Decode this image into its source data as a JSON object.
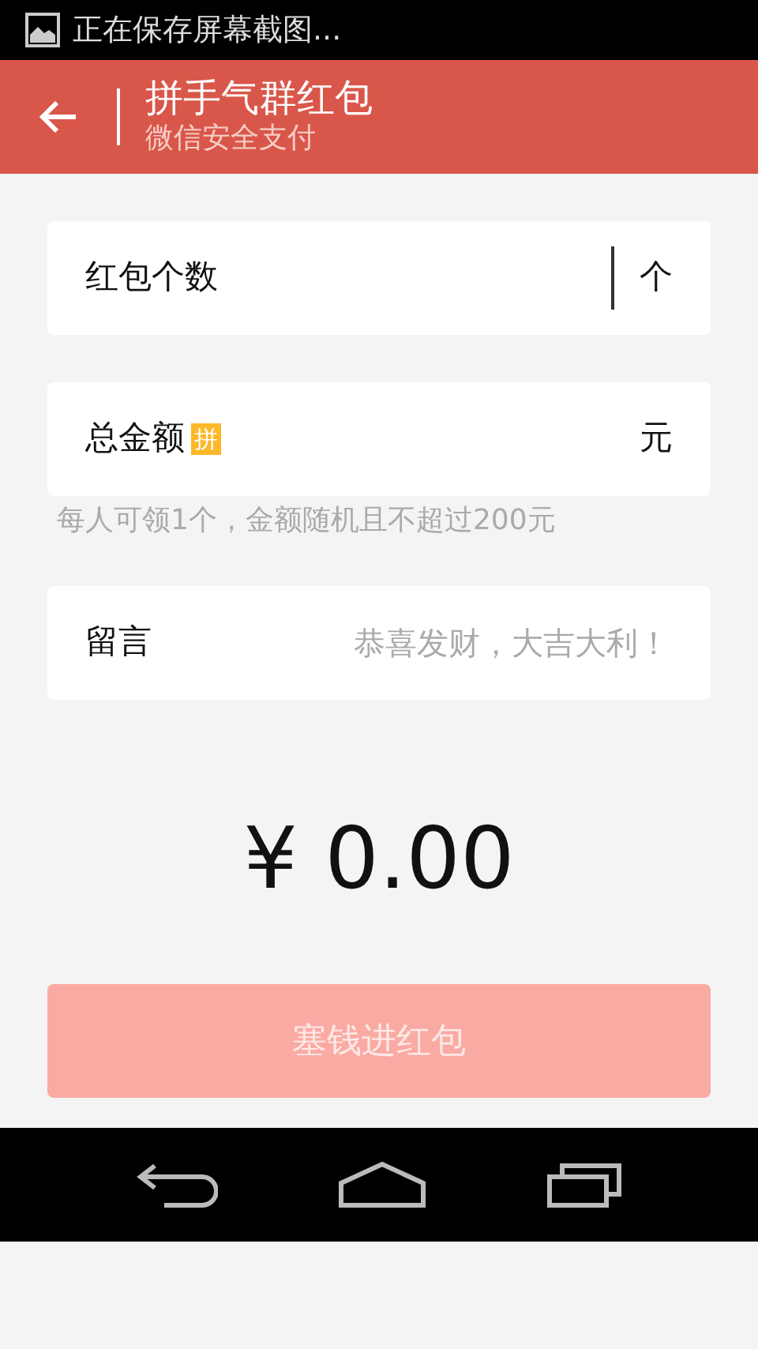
{
  "status_bar": {
    "notification": "正在保存屏幕截图..."
  },
  "header": {
    "title": "拼手气群红包",
    "subtitle": "微信安全支付"
  },
  "fields": [
    {
      "kind": "count",
      "label": "红包个数",
      "unit": "个",
      "focused": true
    },
    {
      "kind": "amount",
      "label": "总金额",
      "badge": "拼",
      "unit": "元",
      "focused": false,
      "hint": "每人可领1个，金额随机且不超过200元"
    },
    {
      "kind": "message",
      "label": "留言",
      "placeholder": "恭喜发财，大吉大利！",
      "focused": false
    }
  ],
  "total": "¥ 0.00",
  "submit_button": {
    "label": "塞钱进红包",
    "disabled": true
  }
}
